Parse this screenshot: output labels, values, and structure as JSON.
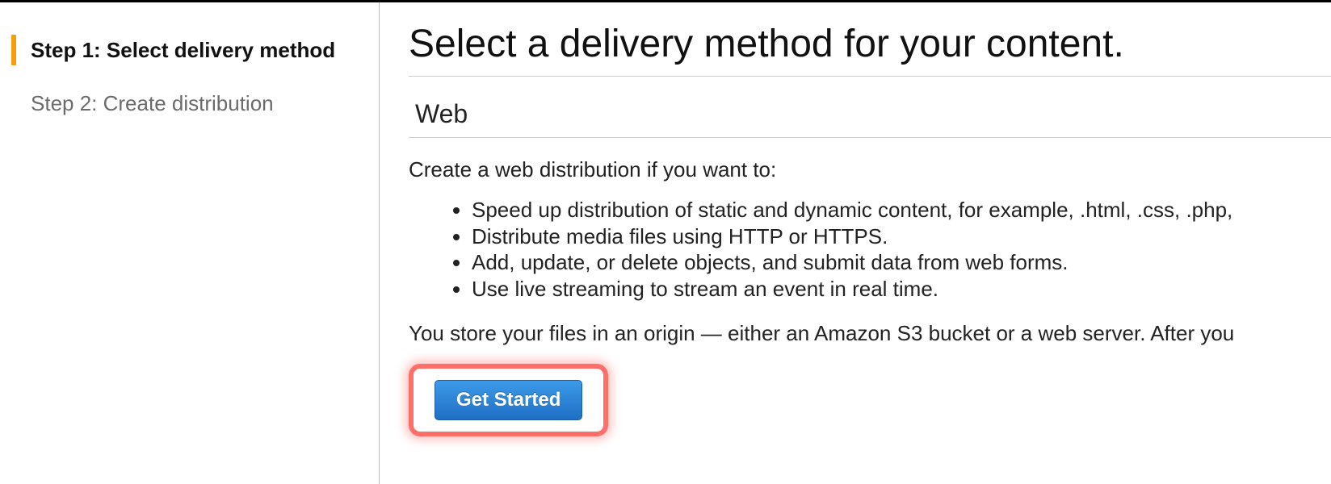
{
  "sidebar": {
    "steps": [
      {
        "label": "Step 1: Select delivery method",
        "active": true
      },
      {
        "label": "Step 2: Create distribution",
        "active": false
      }
    ]
  },
  "main": {
    "title": "Select a delivery method for your content.",
    "section_title": "Web",
    "intro": "Create a web distribution if you want to:",
    "bullets": [
      "Speed up distribution of static and dynamic content, for example, .html, .css, .php,",
      "Distribute media files using HTTP or HTTPS.",
      "Add, update, or delete objects, and submit data from web forms.",
      "Use live streaming to stream an event in real time."
    ],
    "note": "You store your files in an origin — either an Amazon S3 bucket or a web server. After you ",
    "button_label": "Get Started"
  }
}
